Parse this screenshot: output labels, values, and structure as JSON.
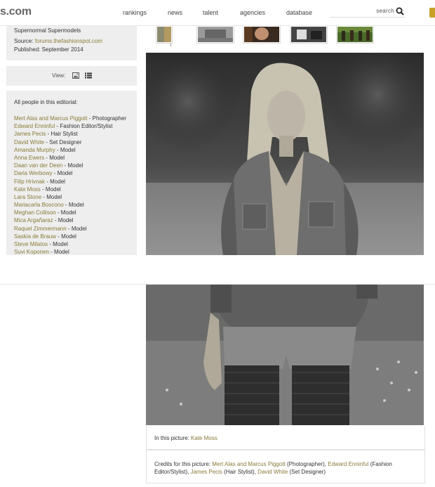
{
  "header": {
    "logo_text": "s.com",
    "nav": [
      "rankings",
      "news",
      "talent",
      "agencies",
      "database"
    ],
    "search_placeholder": "search"
  },
  "editorial": {
    "title": "Supernormal Supermodels",
    "source_label": "Source:",
    "source_link": "forums.thefashionspot.com",
    "published": "Published: September 2014"
  },
  "view": {
    "label": "View:"
  },
  "people": {
    "title": "All people in this editorial:",
    "items": [
      {
        "name": "Mert Alas and Marcus Piggott",
        "role": " - Photographer"
      },
      {
        "name": "Edward Enninful",
        "role": " - Fashion Editor/Stylist"
      },
      {
        "name": "James Pecis",
        "role": " - Hair Stylist"
      },
      {
        "name": "David White",
        "role": " - Set Designer"
      },
      {
        "name": "Amanda Murphy",
        "role": " - Model"
      },
      {
        "name": "Anna Ewers",
        "role": " - Model"
      },
      {
        "name": "Daan van der Deen",
        "role": " - Model"
      },
      {
        "name": "Daria Werbowy",
        "role": " - Model"
      },
      {
        "name": "Filip Hrivnak",
        "role": " - Model"
      },
      {
        "name": "Kate Moss",
        "role": " - Model"
      },
      {
        "name": "Lara Stone",
        "role": " - Model"
      },
      {
        "name": "Mariacarla Boscono",
        "role": " - Model"
      },
      {
        "name": "Meghan Collison",
        "role": " - Model"
      },
      {
        "name": "Mica Argañaraz",
        "role": " - Model"
      },
      {
        "name": "Raquel Zimmermann",
        "role": " - Model"
      },
      {
        "name": "Saskia de Brauw",
        "role": " - Model"
      },
      {
        "name": "Steve Milatos",
        "role": " - Model"
      },
      {
        "name": "Suvi Koponen",
        "role": " - Model"
      }
    ]
  },
  "picture": {
    "in_picture_label": "In this picture:",
    "in_picture_name": "Kate Moss",
    "credits_label": "Credits for this picture:",
    "credits": [
      {
        "name": "Mert Alas and Marcus Piggott",
        "role": " (Photographer), "
      },
      {
        "name": "Edward Enninful",
        "role": " (Fashion Editor/Stylist), "
      },
      {
        "name": "James Pecis",
        "role": " (Hair Stylist), "
      },
      {
        "name": "David White",
        "role": " (Set Designer)"
      }
    ]
  },
  "colors": {
    "link": "#8a7a3a",
    "panel": "#eeeeee",
    "accent": "#c8a028"
  }
}
